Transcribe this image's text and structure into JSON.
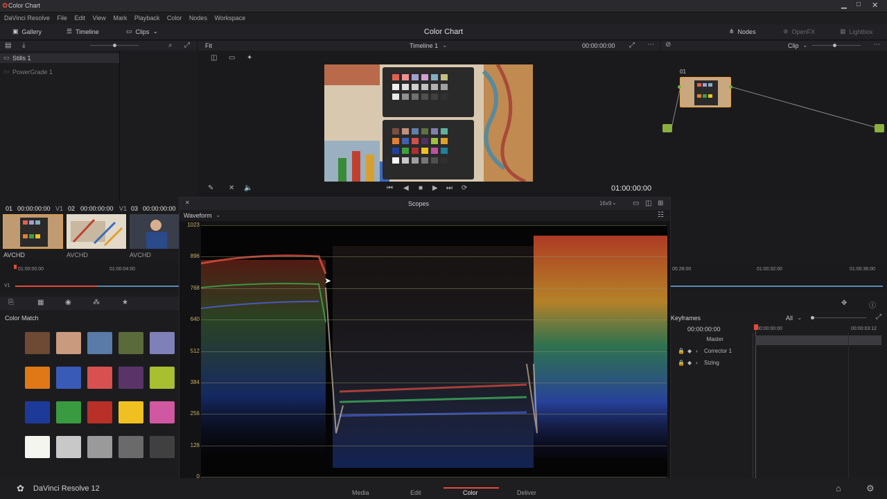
{
  "window": {
    "title": "Color Chart"
  },
  "menu": [
    "DaVinci Resolve",
    "File",
    "Edit",
    "View",
    "Mark",
    "Playback",
    "Color",
    "Nodes",
    "Workspace"
  ],
  "toolbar": {
    "gallery": "Gallery",
    "timeline": "Timeline",
    "clips": "Clips",
    "project_title": "Color Chart",
    "nodes": "Nodes",
    "openfx": "OpenFX",
    "lightbox": "Lightbox"
  },
  "gallery": {
    "stills": "Stills 1",
    "powergrade": "PowerGrade 1"
  },
  "viewer": {
    "fit": "Fit",
    "timeline_name": "Timeline 1",
    "timecode_top": "00:00:00:00",
    "timecode": "01:00:00:00"
  },
  "node_editor": {
    "mode": "Clip",
    "node_label": "01"
  },
  "clips": [
    {
      "num": "01",
      "tc": "00:00:00:00",
      "track": "V1",
      "codec": "AVCHD"
    },
    {
      "num": "02",
      "tc": "00:00:00:00",
      "track": "V1",
      "codec": "AVCHD"
    },
    {
      "num": "03",
      "tc": "00:00:00:00",
      "track": "",
      "codec": "AVCHD"
    }
  ],
  "mini_timeline": {
    "track": "V1",
    "ruler": [
      "01:00:00:00",
      "01:00:04:00"
    ],
    "ruler_right": [
      "00:28:00",
      "01:00:32:00",
      "01:00:36:00"
    ]
  },
  "color_match": {
    "title": "Color Match",
    "swatches": [
      [
        "#6e4a34",
        "#c99a7e",
        "#5a7aa8",
        "#5a6a3a",
        "#8080b8"
      ],
      [
        "#e07818",
        "#3a5ab8",
        "#d85050",
        "#5a3468",
        "#a8c030"
      ],
      [
        "#1e3a98",
        "#3a9a40",
        "#b83028",
        "#f0c020",
        "#d058a0"
      ],
      [
        "#f5f5f0",
        "#c8c8c8",
        "#9a9a9a",
        "#6a6a6a",
        "#404040"
      ]
    ]
  },
  "scopes": {
    "title": "Scopes",
    "aspect": "16x9",
    "type": "Waveform",
    "ticks": [
      "1023",
      "896",
      "768",
      "640",
      "512",
      "384",
      "256",
      "128",
      "0"
    ]
  },
  "keyframes": {
    "title": "Keyframes",
    "filter": "All",
    "tc": "00:00:00:00",
    "ruler": [
      "00:00:00:00",
      "00:00:03:12"
    ],
    "rows": [
      "Master",
      "Corrector 1",
      "Sizing"
    ]
  },
  "app": {
    "name": "DaVinci Resolve 12"
  },
  "pages": [
    "Media",
    "Edit",
    "Color",
    "Deliver"
  ],
  "colors": {
    "accent": "#e64a3a",
    "active_page": "#e64a3a"
  }
}
